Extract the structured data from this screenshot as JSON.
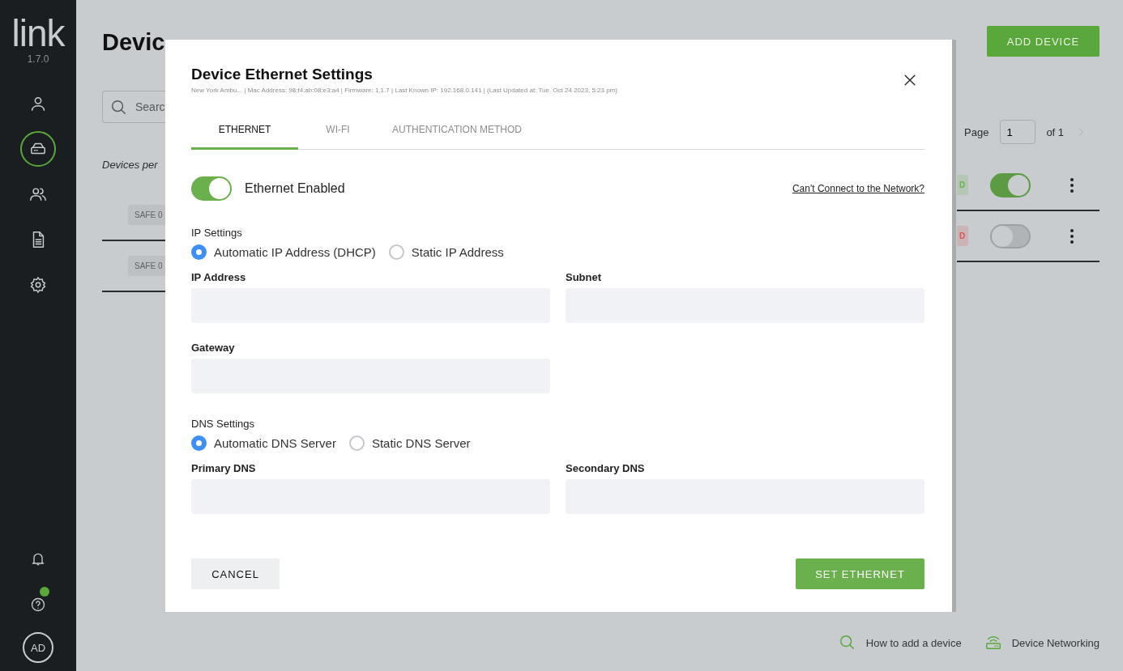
{
  "sidebar": {
    "logo": "link",
    "version": "1.7.0",
    "nav": [
      {
        "selected": false
      },
      {
        "selected": true
      },
      {
        "selected": false
      },
      {
        "selected": false
      },
      {
        "selected": false
      }
    ],
    "help_badge": true,
    "avatar": "AD"
  },
  "page": {
    "title": "Devic",
    "add_button": "ADD DEVICE",
    "search": {
      "placeholder": "Searc"
    },
    "per_page_label": "Devices per",
    "pagination": {
      "label": "Page",
      "value": "1",
      "total": "of 1"
    },
    "rows": [
      {
        "tag": "SAFE 0",
        "status": "D",
        "color": "#6ab04c",
        "enabled": true
      },
      {
        "tag": "SAFE 0",
        "status": "D",
        "color": "#d9534f",
        "enabled": false
      }
    ],
    "footer_links": [
      "How to add a device",
      "Device Networking"
    ]
  },
  "modal": {
    "title": "Device Ethernet Settings",
    "subtitle": "New York Ambu... | Mac Address: 98:f4:ab:08:e3:a4 | Firmware: 1.1.7 | Last Known IP: 192.168.0.141 | (Last Updated at: Tue. Oct 24 2023, 5:23 pm)",
    "tabs": [
      {
        "label": "ETHERNET",
        "selected": true
      },
      {
        "label": "WI-FI",
        "selected": false
      },
      {
        "label": "AUTHENTICATION METHOD",
        "selected": false
      }
    ],
    "ethernet": {
      "label": "Ethernet Enabled",
      "on": true
    },
    "help_link": "Can't Connect to the Network?",
    "ip_settings": {
      "label": "IP Settings",
      "options": [
        {
          "label": "Automatic IP Address (DHCP)",
          "selected": true
        },
        {
          "label": "Static IP Address",
          "selected": false
        }
      ],
      "fields": [
        {
          "label": "IP Address"
        },
        {
          "label": "Subnet"
        },
        {
          "label": "Gateway"
        }
      ]
    },
    "dns_settings": {
      "label": "DNS Settings",
      "options": [
        {
          "label": "Automatic DNS Server",
          "selected": true
        },
        {
          "label": "Static DNS Server",
          "selected": false
        }
      ],
      "fields": [
        {
          "label": "Primary DNS"
        },
        {
          "label": "Secondary DNS"
        }
      ]
    },
    "cancel_button": "CANCEL",
    "submit_button": "SET ETHERNET"
  }
}
